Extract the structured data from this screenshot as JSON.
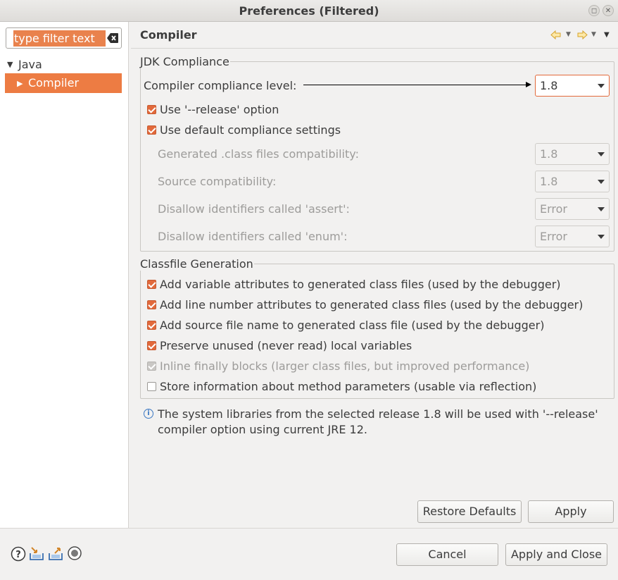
{
  "window": {
    "title": "Preferences (Filtered)",
    "maximize_glyph": "◻",
    "close_glyph": "✕"
  },
  "sidebar": {
    "filter_placeholder": "type filter text",
    "filter_value": "type filter text",
    "tree": [
      {
        "label": "Java",
        "expanded": true
      },
      {
        "label": "Compiler",
        "selected": true
      }
    ]
  },
  "page": {
    "title": "Compiler",
    "nav_icons": [
      "back-arrow-icon",
      "back-menu-icon",
      "forward-arrow-icon",
      "forward-menu-icon",
      "view-menu-icon"
    ]
  },
  "jdk_compliance": {
    "group_label": "JDK Compliance",
    "compliance_level_label": "Compiler compliance level:",
    "compliance_level_value": "1.8",
    "use_release_label": "Use '--release' option",
    "use_release_checked": true,
    "use_default_label": "Use default compliance settings",
    "use_default_checked": true,
    "rows": [
      {
        "label": "Generated .class files compatibility:",
        "value": "1.8"
      },
      {
        "label": "Source compatibility:",
        "value": "1.8"
      },
      {
        "label": "Disallow identifiers called 'assert':",
        "value": "Error"
      },
      {
        "label": "Disallow identifiers called 'enum':",
        "value": "Error"
      }
    ]
  },
  "classfile_generation": {
    "group_label": "Classfile Generation",
    "options": [
      {
        "label": "Add variable attributes to generated class files (used by the debugger)",
        "checked": true,
        "enabled": true
      },
      {
        "label": "Add line number attributes to generated class files (used by the debugger)",
        "checked": true,
        "enabled": true
      },
      {
        "label": "Add source file name to generated class file (used by the debugger)",
        "checked": true,
        "enabled": true
      },
      {
        "label": "Preserve unused (never read) local variables",
        "checked": true,
        "enabled": true
      },
      {
        "label": "Inline finally blocks (larger class files, but improved performance)",
        "checked": true,
        "enabled": false
      },
      {
        "label": "Store information about method parameters (usable via reflection)",
        "checked": false,
        "enabled": true
      }
    ]
  },
  "info": {
    "line1": "The system libraries from the selected release 1.8 will be used with '--release'",
    "line2": "compiler option using current JRE 12."
  },
  "buttons": {
    "restore_defaults": "Restore Defaults",
    "apply": "Apply",
    "cancel": "Cancel",
    "apply_and_close": "Apply and Close"
  },
  "colors": {
    "accent": "#ed7c43",
    "checkbox": "#e2693b",
    "info": "#3a77c2"
  }
}
